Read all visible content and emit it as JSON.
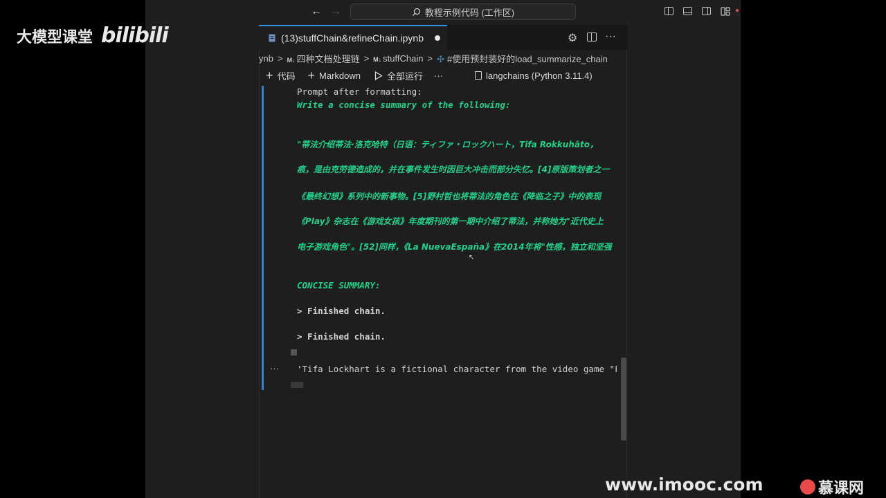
{
  "titlebar": {
    "back": "←",
    "forward": "→",
    "search_text": "教程示例代码 (工作区)"
  },
  "tab": {
    "title": "(13)stuffChain&refineChain.ipynb"
  },
  "breadcrumb": {
    "items": [
      "ynb",
      "四种文档处理链",
      "stuffChain",
      "#使用预封装好的load_summarize_chain"
    ],
    "md_badge": "M↓",
    "sep": ">"
  },
  "toolbar": {
    "code": "代码",
    "markdown": "Markdown",
    "run_all": "全部运行",
    "more": "···",
    "kernel": "langchains (Python 3.11.4)"
  },
  "output": {
    "prompt_after": "Prompt after formatting:",
    "write_concise": "Write a concise summary of the following:",
    "cn_lines": [
      "\"蒂法介绍蒂法·洛克哈特（日语：ティファ・ロックハート，Tifa Rokkuhāto，",
      "痕，是由克劳德造成的，并在事件发生时因巨大冲击而部分失忆。[4]原版策划者之一",
      "《最终幻想》系列中的新事物。[5]野村哲也将蒂法的角色在《降临之子》中的表现",
      "《Play》杂志在《游戏女孩》年度期刊的第一期中介绍了蒂法，并称她为\"近代史上",
      "电子游戏角色\"。[52]同样，《La NuevaEspaña》在2014年将\"性感，独立和坚强"
    ],
    "concise_summary": "CONCISE SUMMARY:",
    "finished_1": "> Finished chain.",
    "finished_2": "> Finished chain.",
    "result_ellipsis": "···",
    "result": "'Tifa Lockhart is a fictional character from the video game \"F"
  },
  "watermarks": {
    "left_text": "大模型课堂",
    "left_logo": "bilibili",
    "right_url": "www.imooc.com",
    "right_brand": "慕课网"
  },
  "colors": {
    "accent": "#3b8eea",
    "green_text": "#23d18b",
    "cell_bar": "#3b7fd0"
  }
}
